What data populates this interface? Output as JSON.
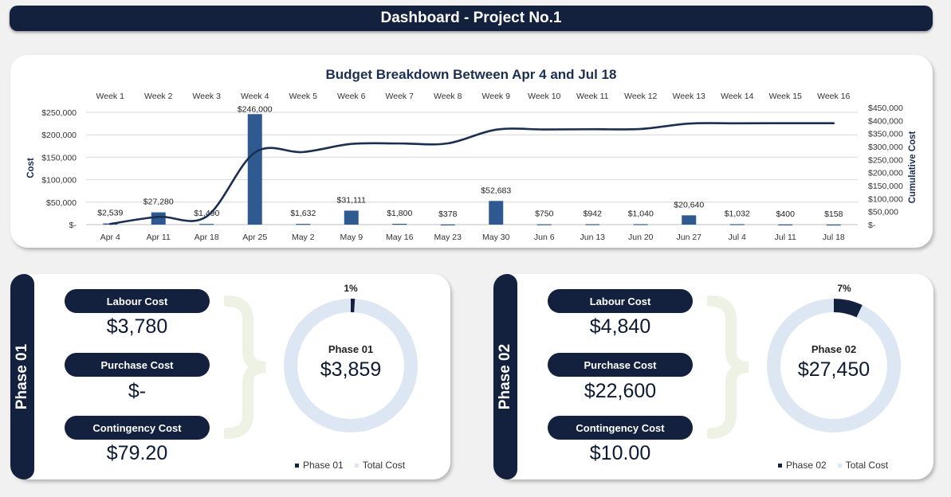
{
  "header": {
    "title": "Dashboard - Project No.1"
  },
  "chart_data": {
    "type": "bar",
    "title": "Budget Breakdown Between Apr 4 and Jul 18",
    "ylabel": "Cost",
    "y2label": "Cumulative Cost",
    "weeks": [
      "Week 1",
      "Week 2",
      "Week 3",
      "Week 4",
      "Week 5",
      "Week 6",
      "Week 7",
      "Week 8",
      "Week 9",
      "Week 10",
      "Week 11",
      "Week 12",
      "Week 13",
      "Week 14",
      "Week 15",
      "Week 16"
    ],
    "categories": [
      "Apr 4",
      "Apr 11",
      "Apr 18",
      "Apr 25",
      "May 2",
      "May 9",
      "May 16",
      "May 23",
      "May 30",
      "Jun 6",
      "Jun 13",
      "Jun 20",
      "Jun 27",
      "Jul 4",
      "Jul 11",
      "Jul 18"
    ],
    "values": [
      2539,
      27280,
      1490,
      246000,
      1632,
      31111,
      1800,
      378,
      52683,
      750,
      942,
      1040,
      20640,
      1032,
      400,
      158
    ],
    "value_labels": [
      "$2,539",
      "$27,280",
      "$1,490",
      "$246,000",
      "$1,632",
      "$31,111",
      "$1,800",
      "$378",
      "$52,683",
      "$750",
      "$942",
      "$1,040",
      "$20,640",
      "$1,032",
      "$400",
      "$158"
    ],
    "cumulative": [
      2539,
      29819,
      31309,
      277309,
      278941,
      310052,
      311852,
      312230,
      364913,
      365663,
      366605,
      367645,
      388285,
      389317,
      389717,
      389875
    ],
    "ylim": [
      0,
      250000
    ],
    "y_ticks": [
      0,
      50000,
      100000,
      150000,
      200000,
      250000
    ],
    "y_tick_labels": [
      "$-",
      "$50,000",
      "$100,000",
      "$150,000",
      "$200,000",
      "$250,000"
    ],
    "y2lim": [
      0,
      450000
    ],
    "y2_ticks": [
      0,
      50000,
      100000,
      150000,
      200000,
      250000,
      300000,
      350000,
      400000,
      450000
    ],
    "y2_tick_labels": [
      "$-",
      "$50,000",
      "$100,000",
      "$150,000",
      "$200,000",
      "$250,000",
      "$300,000",
      "$350,000",
      "$400,000",
      "$450,000"
    ],
    "colors": {
      "bar": "#2f5a91",
      "line": "#1b2f52",
      "grid": "#d9d9d9"
    }
  },
  "phase1": {
    "side_label": "Phase 01",
    "labour_label": "Labour Cost",
    "labour_value": "$3,780",
    "purchase_label": "Purchase Cost",
    "purchase_value": "$-",
    "contingency_label": "Contingency Cost",
    "contingency_value": "$79.20",
    "donut_title": "Phase 01",
    "donut_value": "$3,859",
    "donut_pct": "1%",
    "fraction": 0.01,
    "legend_phase": "Phase 01",
    "legend_total": "Total Cost"
  },
  "phase2": {
    "side_label": "Phase 02",
    "labour_label": "Labour Cost",
    "labour_value": "$4,840",
    "purchase_label": "Purchase Cost",
    "purchase_value": "$22,600",
    "contingency_label": "Contingency Cost",
    "contingency_value": "$10.00",
    "donut_title": "Phase 02",
    "donut_value": "$27,450",
    "donut_pct": "7%",
    "fraction": 0.07,
    "legend_phase": "Phase 02",
    "legend_total": "Total Cost"
  },
  "colors": {
    "navy": "#13213e",
    "ring": "#dde6f3",
    "brace": "#eef2e4"
  }
}
